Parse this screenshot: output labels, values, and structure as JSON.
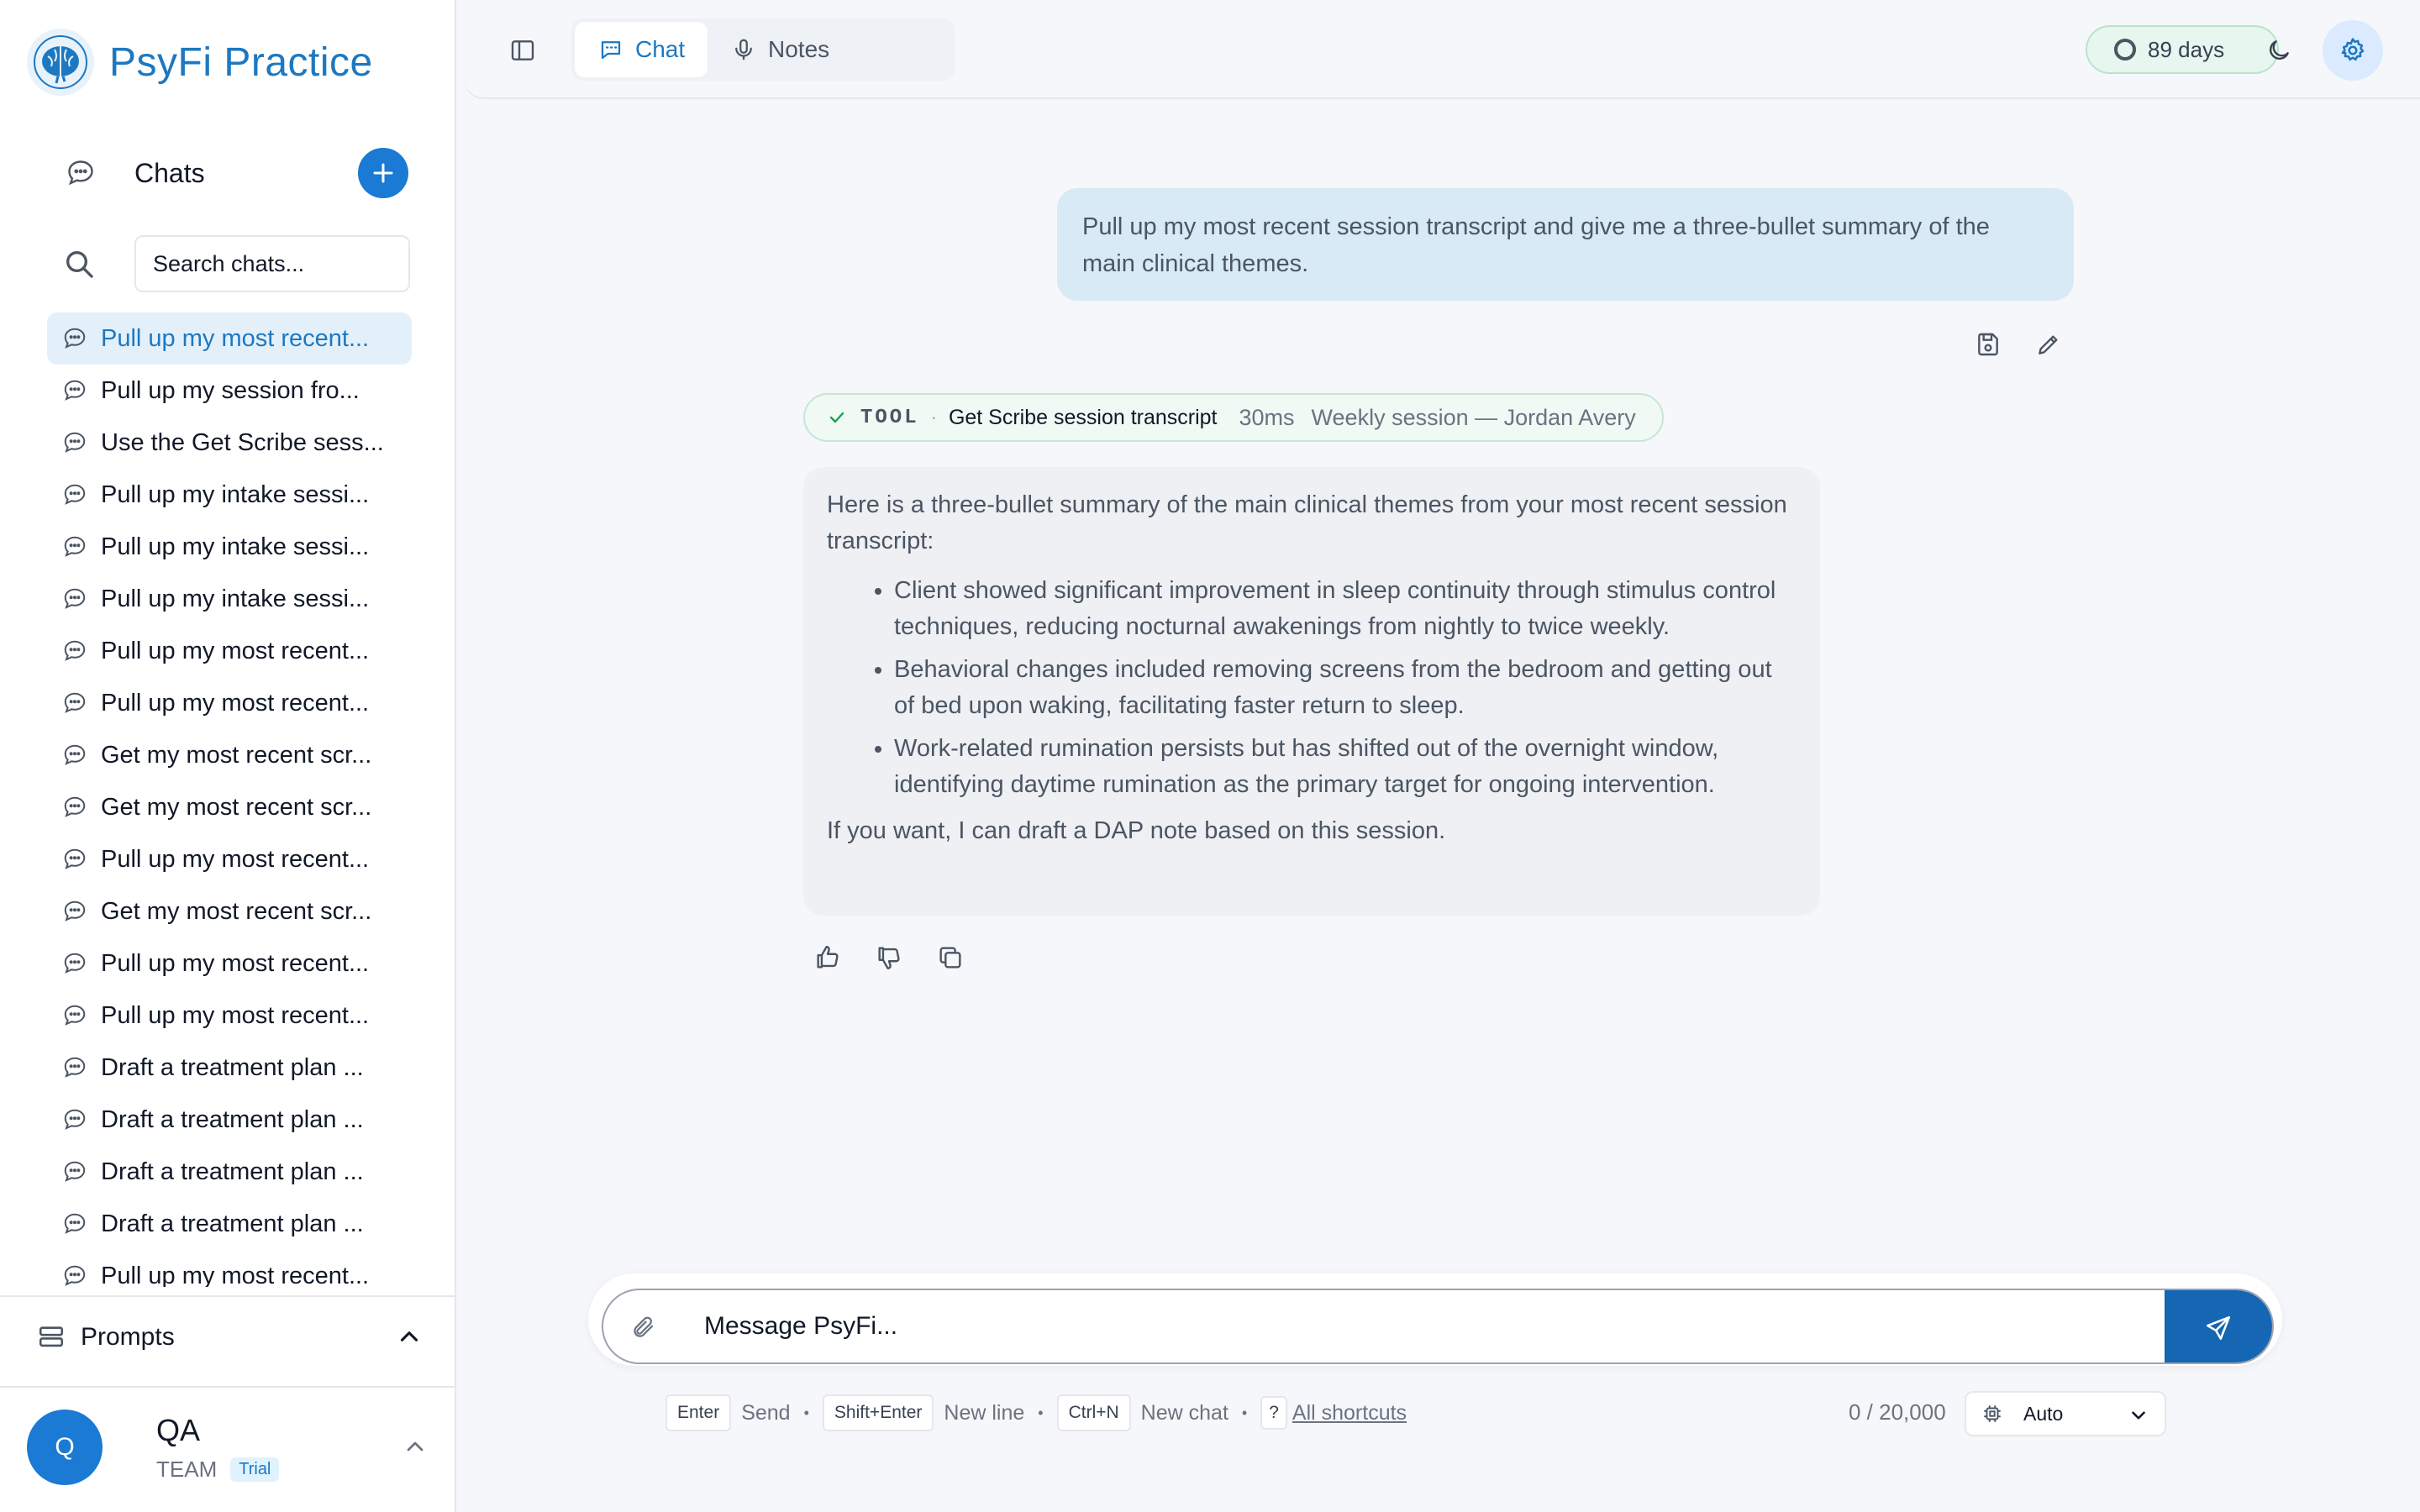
{
  "app": {
    "name": "PsyFi Practice"
  },
  "sidebar": {
    "chats_label": "Chats",
    "search_placeholder": "Search chats...",
    "chats": [
      "Pull up my most recent...",
      "Pull up my session fro...",
      "Use the Get Scribe sess...",
      "Pull up my intake sessi...",
      "Pull up my intake sessi...",
      "Pull up my intake sessi...",
      "Pull up my most recent...",
      "Pull up my most recent...",
      "Get my most recent scr...",
      "Get my most recent scr...",
      "Pull up my most recent...",
      "Get my most recent scr...",
      "Pull up my most recent...",
      "Pull up my most recent...",
      "Draft a treatment plan ...",
      "Draft a treatment plan ...",
      "Draft a treatment plan ...",
      "Draft a treatment plan ...",
      "Pull up my most recent..."
    ],
    "prompts_label": "Prompts",
    "user": {
      "initial": "Q",
      "name": "QA",
      "team": "TEAM",
      "badge": "Trial"
    }
  },
  "topbar": {
    "tabs": [
      "Chat",
      "Notes"
    ],
    "active_tab": "Chat",
    "trial_days": "89 days"
  },
  "conversation": {
    "user_message": "Pull up my most recent session transcript and give me a three-bullet summary of the main clinical themes.",
    "tool_call": {
      "tag": "TOOL",
      "name": "Get Scribe session transcript",
      "duration": "30ms",
      "detail": "Weekly session — Jordan Avery",
      "status": "success"
    },
    "assistant": {
      "intro": "Here is a three-bullet summary of the main clinical themes from your most recent session transcript:",
      "bullets": [
        "Client showed significant improvement in sleep continuity through stimulus control techniques, reducing nocturnal awakenings from nightly to twice weekly.",
        "Behavioral changes included removing screens from the bedroom and getting out of bed upon waking, facilitating faster return to sleep.",
        "Work-related rumination persists but has shifted out of the overnight window, identifying daytime rumination as the primary target for ongoing intervention."
      ],
      "outro": "If you want, I can draft a DAP note based on this session."
    }
  },
  "composer": {
    "placeholder": "Message PsyFi...",
    "shortcuts": [
      {
        "key": "Enter",
        "label": "Send"
      },
      {
        "key": "Shift+Enter",
        "label": "New line"
      },
      {
        "key": "Ctrl+N",
        "label": "New chat"
      }
    ],
    "help_key": "?",
    "all_shortcuts": "All shortcuts",
    "counter": "0 / 20,000",
    "mode": "Auto"
  },
  "colors": {
    "accent": "#1a7ad4",
    "send": "#1566b3",
    "user_bubble": "#d8eaf6",
    "tool_pill": "#f0f9f4"
  }
}
